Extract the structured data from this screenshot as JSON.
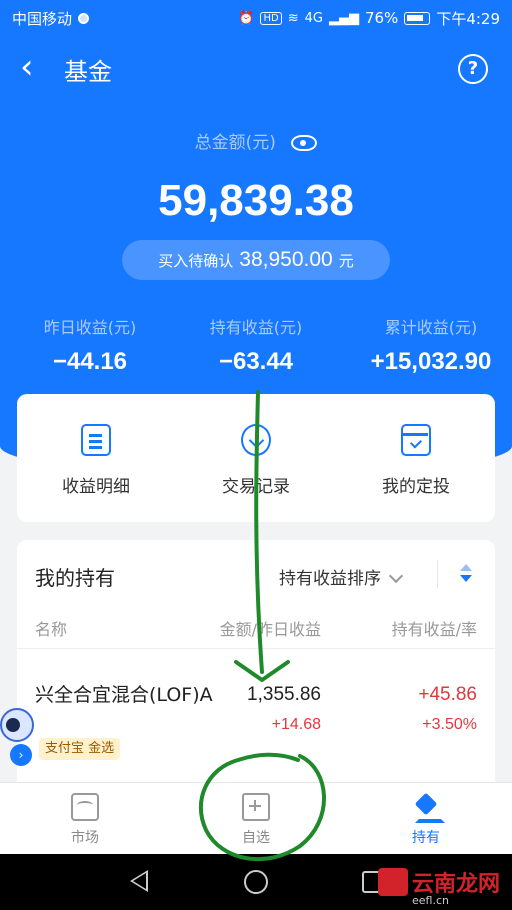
{
  "status": {
    "carrier": "中国移动",
    "network": "4G",
    "battery": "76%",
    "time": "下午4:29"
  },
  "nav": {
    "title": "基金"
  },
  "summary": {
    "total_label": "总金额(元)",
    "total_amount": "59,839.38",
    "pending_label": "买入待确认",
    "pending_amount": "38,950.00",
    "pending_unit": "元"
  },
  "stats": [
    {
      "label": "昨日收益(元)",
      "value": "−44.16"
    },
    {
      "label": "持有收益(元)",
      "value": "−63.44"
    },
    {
      "label": "累计收益(元)",
      "value": "+15,032.90"
    }
  ],
  "actions": [
    {
      "label": "收益明细",
      "icon": "document-icon"
    },
    {
      "label": "交易记录",
      "icon": "clock-icon"
    },
    {
      "label": "我的定投",
      "icon": "calendar-check-icon"
    }
  ],
  "holdings": {
    "title": "我的持有",
    "sort_label": "持有收益排序",
    "columns": [
      "名称",
      "金额/昨日收益",
      "持有收益/率"
    ],
    "rows": [
      {
        "name": "兴全合宜混合(LOF)A",
        "amount": "1,355.86",
        "daily": "+14.68",
        "profit": "+45.86",
        "rate": "+3.50%",
        "badge": "支付宝 金选"
      }
    ]
  },
  "tabs": [
    {
      "label": "市场",
      "icon": "market-icon"
    },
    {
      "label": "自选",
      "icon": "watchlist-add-icon"
    },
    {
      "label": "持有",
      "icon": "layers-icon"
    }
  ],
  "watermark": {
    "text": "云南龙网",
    "url": "eefl.cn"
  },
  "colors": {
    "primary": "#1677ff",
    "red": "#e3373a",
    "annotation": "#1f8a2a"
  }
}
